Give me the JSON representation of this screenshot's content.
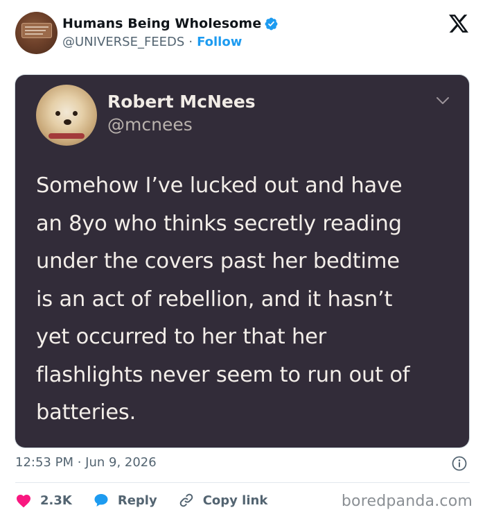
{
  "header": {
    "display_name": "Humans Being Wholesome",
    "handle": "@UNIVERSE_FEEDS",
    "separator": "·",
    "follow_label": "Follow"
  },
  "embedded_tweet": {
    "name": "Robert McNees",
    "handle": "@mcnees",
    "text": "Somehow I’ve lucked out and have\nan 8yo who thinks secretly reading\nunder the covers past her bedtime\nis an act of rebellion, and it hasn’t\nyet occurred to her that her\nflashlights never seem to run out of\nbatteries."
  },
  "meta": {
    "timestamp": "12:53 PM · Jun 9, 2026"
  },
  "actions": {
    "like_count": "2.3K",
    "reply_label": "Reply",
    "copy_link_label": "Copy link"
  },
  "watermark": "boredpanda.com",
  "colors": {
    "accent": "#1d9bf0",
    "like": "#f91880",
    "embed_bg": "#322c39",
    "muted": "#536471"
  },
  "icons": [
    "verified-badge-icon",
    "x-logo-icon",
    "chevron-down-icon",
    "info-icon",
    "heart-icon",
    "reply-bubble-icon",
    "link-icon"
  ]
}
